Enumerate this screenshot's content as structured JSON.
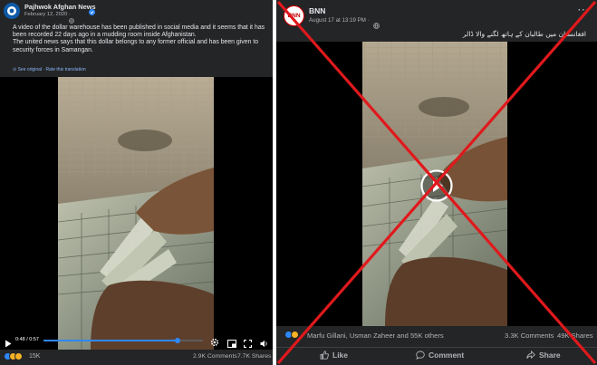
{
  "left_post": {
    "page_name": "Pajhwok Afghan News",
    "date": "February 12, 2020 · ",
    "text_lines": [
      "A video of the dollar warehouse has been published in social media and it seems that it has",
      "been recorded 22 days ago in a mudding room inside Afghanistan.",
      "The united news says that this dollar belongs to any former official and has been given to",
      "security forces in Samangan."
    ],
    "see_original": "See original · Rate this translation",
    "video_time": "0:48 / 0:57",
    "video_progress_fraction": 0.84,
    "reaction_count": "15K",
    "comments": "2.9K Comments",
    "shares": "7.7K Shares"
  },
  "right_post": {
    "page_name": "BNN",
    "avatar_text": "BNN",
    "date": "August 17 at 13:19 PM · ",
    "caption": "افغانستان میں طالبان کے ہاتھ لگنے والا ڈالر",
    "reactions_text": "Marfu Gillani, Usman Zaheer and 55K others",
    "comments": "3.3K Comments",
    "views": "49K Shares",
    "actions": {
      "like": "Like",
      "comment": "Comment",
      "share": "Share"
    }
  },
  "colors": {
    "panel_bg": "#242526",
    "text": "#e4e6eb",
    "muted": "#b0b3b8",
    "accent": "#2d88ff",
    "cross_red": "#e0191c"
  },
  "icons": [
    "verified-badge-icon",
    "globe-icon",
    "more-icon",
    "play-icon",
    "volume-icon",
    "settings-icon",
    "fullscreen-icon",
    "like-icon",
    "comment-icon",
    "share-icon"
  ]
}
